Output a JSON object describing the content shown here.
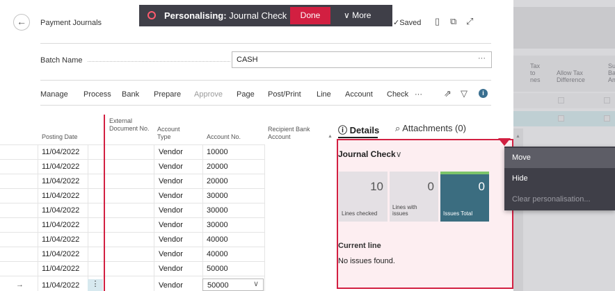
{
  "personalise_bar": {
    "title_bold": "Personalising:",
    "title_rest": "Journal Check",
    "done_label": "Done",
    "more_label": "More"
  },
  "header": {
    "page_title": "Payment Journals",
    "saved_label": "Saved"
  },
  "batch": {
    "label": "Batch Name",
    "value": "CASH",
    "lookup": "···"
  },
  "actions": [
    "Manage",
    "Process",
    "Bank",
    "Prepare",
    "Approve",
    "Page",
    "Post/Print",
    "Line",
    "Account",
    "Check",
    "···"
  ],
  "grid": {
    "columns": [
      "Posting Date",
      "External Document No.",
      "Account Type",
      "Account No.",
      "Recipient Bank Account"
    ],
    "rows": [
      {
        "date": "11/04/2022",
        "type": "Vendor",
        "account": "10000"
      },
      {
        "date": "11/04/2022",
        "type": "Vendor",
        "account": "20000"
      },
      {
        "date": "11/04/2022",
        "type": "Vendor",
        "account": "20000"
      },
      {
        "date": "11/04/2022",
        "type": "Vendor",
        "account": "30000"
      },
      {
        "date": "11/04/2022",
        "type": "Vendor",
        "account": "30000"
      },
      {
        "date": "11/04/2022",
        "type": "Vendor",
        "account": "30000"
      },
      {
        "date": "11/04/2022",
        "type": "Vendor",
        "account": "40000"
      },
      {
        "date": "11/04/2022",
        "type": "Vendor",
        "account": "40000"
      },
      {
        "date": "11/04/2022",
        "type": "Vendor",
        "account": "50000"
      },
      {
        "date": "11/04/2022",
        "type": "Vendor",
        "account": "50000"
      }
    ],
    "current_row_marker": "→",
    "row_menu_glyph": "⋮"
  },
  "factbox": {
    "tabs": [
      "Details",
      "Attachments (0)"
    ],
    "journal_check": {
      "title": "Journal Check",
      "tiles": [
        {
          "value": "10",
          "label": "Lines checked"
        },
        {
          "value": "0",
          "label": "Lines with issues"
        },
        {
          "value": "0",
          "label": "Issues Total"
        }
      ],
      "current_line_label": "Current line",
      "current_line_value": "No issues found."
    }
  },
  "context_menu": {
    "items": [
      "Move",
      "Hide",
      "Clear personalisation..."
    ]
  },
  "background_page": {
    "columns": [
      "Tax\nto\nnes",
      "Allow Tax\nDifference",
      "Sugg\nBalar\nAmo"
    ]
  },
  "colors": {
    "accent_red": "#d21f41",
    "bar_dark": "#3f3f48",
    "tile_dark": "#3b6d80",
    "tile_green": "#7cc46a"
  }
}
